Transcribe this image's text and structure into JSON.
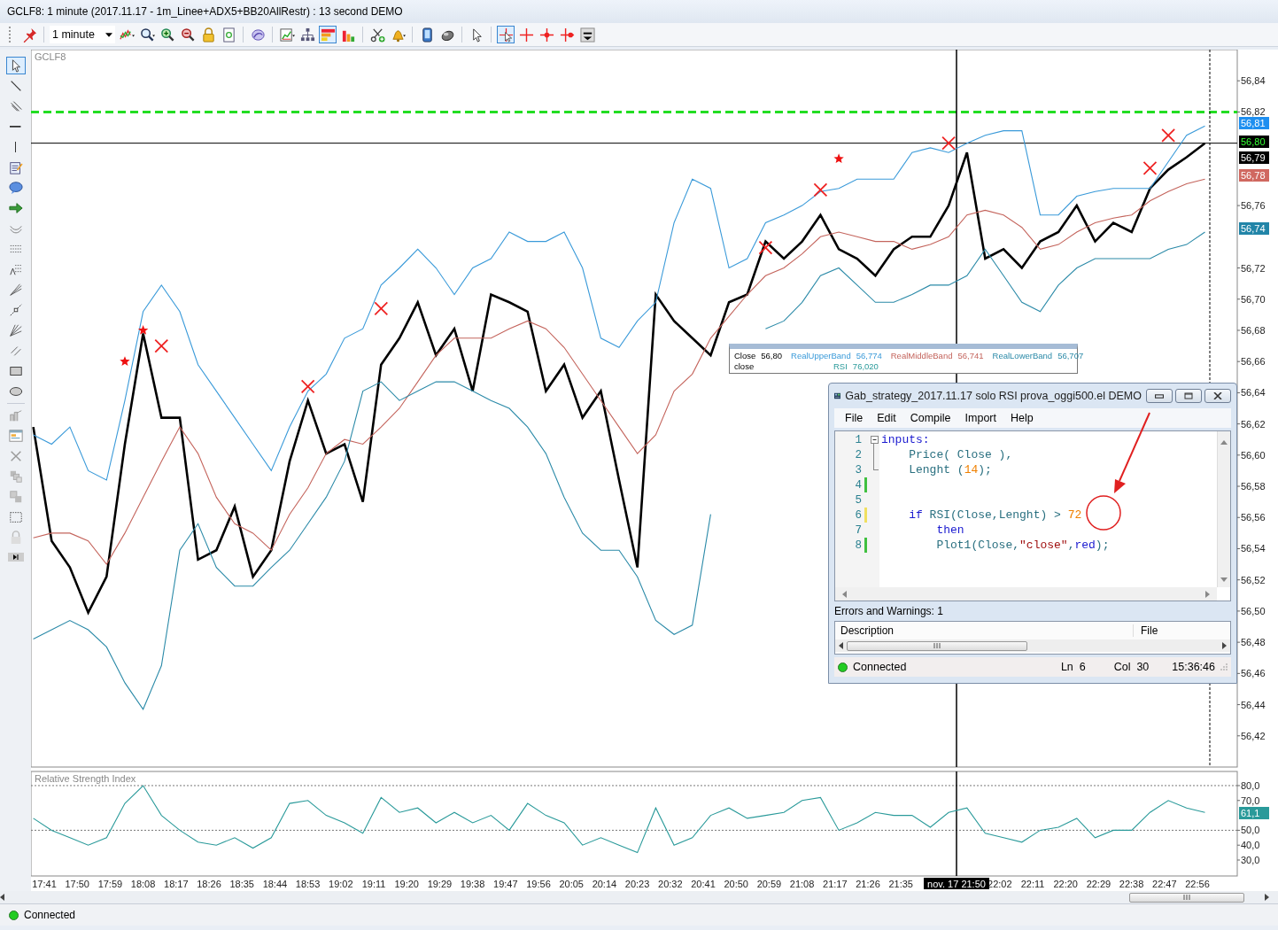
{
  "window": {
    "title": "GCLF8: 1 minute (2017.11.17 - 1m_Linee+ADX5+BB20AllRestr) : 13 second DEMO"
  },
  "toolbar": {
    "interval": "1 minute",
    "buttons": [
      {
        "selected": false
      },
      {
        "selected": false
      },
      {
        "selected": false
      },
      {
        "selected": false
      },
      {
        "selected": false
      },
      {
        "selected": false
      },
      {
        "selected": false
      },
      {
        "selected": false
      },
      {
        "selected": false
      },
      {
        "selected": false
      },
      {
        "selected": true
      },
      {
        "selected": false
      },
      {
        "selected": false
      },
      {
        "selected": false
      },
      {
        "selected": false
      },
      {
        "selected": false
      },
      {
        "selected": false
      },
      {
        "selected": true
      },
      {
        "selected": false
      },
      {
        "selected": false
      },
      {
        "selected": false
      },
      {
        "selected": false
      }
    ]
  },
  "drawing_tools": [
    {
      "selected": true
    },
    {
      "selected": false
    },
    {
      "selected": false
    },
    {
      "selected": false
    },
    {
      "selected": false
    },
    {
      "selected": false
    },
    {
      "selected": false
    },
    {
      "selected": false
    },
    {
      "selected": false
    },
    {
      "selected": false
    },
    {
      "selected": false
    },
    {
      "selected": false
    },
    {
      "selected": false
    },
    {
      "selected": false
    },
    {
      "selected": false
    },
    {
      "selected": false
    },
    {
      "selected": false
    },
    {
      "selected": false
    },
    {
      "selected": false
    },
    {
      "selected": false
    },
    {
      "selected": false
    },
    {
      "selected": false
    },
    {
      "selected": false
    },
    {
      "selected": false
    }
  ],
  "price_chart": {
    "title": "GCLF8",
    "chart_data": {
      "type": "line",
      "categories": [
        null,
        null,
        null,
        null,
        null,
        null,
        null,
        null,
        null,
        null,
        null,
        null,
        null,
        null,
        null,
        null,
        null,
        null,
        null,
        null,
        null,
        null,
        null,
        null,
        null,
        null,
        null,
        null,
        null,
        null,
        null,
        null,
        null,
        null,
        null,
        null,
        null,
        null,
        null,
        null,
        null,
        null,
        null,
        null,
        null,
        null,
        null,
        null,
        null,
        null,
        null,
        null,
        null,
        null,
        null,
        null,
        null,
        null,
        null,
        null,
        null,
        null,
        null,
        null,
        null
      ],
      "ylim": [
        56.4,
        56.86
      ],
      "yticks": [
        {
          "value": 56.42,
          "label": "56,42"
        },
        {
          "value": 56.44,
          "label": "56,44"
        },
        {
          "value": 56.46,
          "label": "56,46"
        },
        {
          "value": 56.48,
          "label": "56,48"
        },
        {
          "value": 56.5,
          "label": "56,50"
        },
        {
          "value": 56.52,
          "label": "56,52"
        },
        {
          "value": 56.54,
          "label": "56,54"
        },
        {
          "value": 56.56,
          "label": "56,56"
        },
        {
          "value": 56.58,
          "label": "56,58"
        },
        {
          "value": 56.6,
          "label": "56,60"
        },
        {
          "value": 56.62,
          "label": "56,62"
        },
        {
          "value": 56.64,
          "label": "56,64"
        },
        {
          "value": 56.66,
          "label": "56,66"
        },
        {
          "value": 56.68,
          "label": "56,68"
        },
        {
          "value": 56.7,
          "label": "56,70"
        },
        {
          "value": 56.72,
          "label": "56,72"
        },
        {
          "value": 56.76,
          "label": "56,76"
        },
        {
          "value": 56.82,
          "label": "56,82"
        },
        {
          "value": 56.84,
          "label": "56,84"
        }
      ],
      "series": [
        {
          "name": "Close",
          "color": "#000000",
          "values": [
            56.618,
            56.545,
            56.528,
            56.499,
            56.522,
            56.607,
            56.678,
            56.624,
            56.624,
            56.533,
            56.539,
            56.567,
            56.522,
            56.539,
            56.596,
            56.635,
            56.601,
            56.607,
            56.57,
            56.658,
            56.675,
            56.698,
            56.664,
            56.681,
            56.641,
            56.703,
            56.698,
            56.692,
            56.641,
            56.658,
            56.624,
            56.641,
            56.584,
            56.528,
            56.703,
            56.686,
            56.675,
            56.664,
            56.698,
            56.703,
            56.737,
            56.726,
            56.737,
            56.754,
            56.732,
            56.726,
            56.715,
            56.732,
            56.74,
            56.74,
            56.76,
            56.794,
            56.726,
            56.732,
            56.72,
            56.737,
            56.743,
            56.76,
            56.737,
            56.749,
            56.743,
            56.771,
            56.783,
            56.791,
            56.8
          ]
        },
        {
          "name": "RealUpperBand",
          "color": "#3a9ad9",
          "values": [
            56.613,
            56.607,
            56.618,
            56.59,
            56.584,
            56.635,
            56.692,
            56.709,
            56.692,
            56.658,
            56.641,
            56.624,
            56.607,
            56.59,
            56.618,
            56.641,
            56.652,
            56.675,
            56.681,
            56.709,
            56.72,
            56.732,
            56.72,
            56.703,
            56.72,
            56.726,
            56.743,
            56.737,
            56.737,
            56.743,
            56.72,
            56.675,
            56.669,
            56.686,
            56.698,
            56.749,
            56.777,
            56.771,
            56.72,
            56.726,
            56.749,
            56.754,
            56.76,
            56.769,
            56.771,
            56.777,
            56.777,
            56.777,
            56.794,
            56.797,
            56.794,
            56.8,
            56.805,
            56.808,
            56.808,
            56.754,
            56.754,
            56.766,
            56.769,
            56.771,
            56.771,
            56.771,
            56.788,
            56.805,
            56.811
          ]
        },
        {
          "name": "RealMiddleBand",
          "color": "#c4645c",
          "values": [
            56.547,
            56.55,
            56.55,
            56.545,
            56.53,
            56.55,
            56.573,
            56.596,
            56.618,
            56.601,
            56.573,
            56.556,
            56.55,
            56.539,
            56.562,
            56.579,
            56.601,
            56.61,
            56.607,
            56.618,
            56.63,
            56.647,
            56.664,
            56.675,
            56.675,
            56.675,
            56.681,
            56.686,
            56.681,
            56.669,
            56.652,
            56.635,
            56.618,
            56.601,
            56.613,
            56.641,
            56.652,
            56.675,
            56.689,
            56.703,
            56.715,
            56.72,
            56.729,
            56.74,
            56.743,
            56.74,
            56.737,
            56.737,
            56.732,
            56.735,
            56.74,
            56.754,
            56.757,
            56.754,
            56.746,
            56.732,
            56.735,
            56.743,
            56.749,
            56.752,
            56.754,
            56.763,
            56.769,
            56.774,
            56.777
          ]
        },
        {
          "name": "RealLowerBand",
          "color": "#2b8aa8",
          "values": [
            56.482,
            56.488,
            56.494,
            56.488,
            56.477,
            56.454,
            56.437,
            56.465,
            56.539,
            56.556,
            56.528,
            56.516,
            56.516,
            56.528,
            56.539,
            56.556,
            56.573,
            56.596,
            56.641,
            56.647,
            56.635,
            56.641,
            56.647,
            56.647,
            56.641,
            56.635,
            56.63,
            56.618,
            56.601,
            56.573,
            56.55,
            56.539,
            56.539,
            56.522,
            56.494,
            56.485,
            56.491,
            56.562,
            null,
            null,
            56.681,
            56.686,
            56.698,
            56.715,
            56.72,
            56.709,
            56.698,
            56.698,
            56.703,
            56.709,
            56.709,
            56.715,
            56.732,
            56.715,
            56.698,
            56.692,
            56.709,
            56.72,
            56.726,
            56.726,
            56.726,
            56.726,
            56.732,
            56.735,
            56.743
          ]
        },
        {
          "name": "close",
          "color": "#ee2222",
          "type": "scatter",
          "marker": "x",
          "values": [
            null,
            null,
            null,
            null,
            null,
            null,
            null,
            56.67,
            null,
            null,
            null,
            null,
            null,
            null,
            null,
            56.644,
            null,
            null,
            null,
            56.694,
            null,
            null,
            null,
            null,
            null,
            null,
            null,
            null,
            null,
            null,
            null,
            null,
            null,
            null,
            null,
            null,
            null,
            null,
            null,
            null,
            56.733,
            null,
            null,
            56.77,
            null,
            null,
            null,
            null,
            null,
            null,
            56.8,
            null,
            null,
            null,
            null,
            null,
            null,
            null,
            null,
            null,
            null,
            56.784,
            56.805,
            null,
            null
          ]
        },
        {
          "color": "#ee1111",
          "type": "scatter",
          "marker": "star",
          "values": [
            null,
            null,
            null,
            null,
            null,
            56.66,
            56.68,
            null,
            null,
            null,
            null,
            null,
            null,
            null,
            null,
            null,
            null,
            null,
            null,
            null,
            null,
            null,
            null,
            null,
            null,
            null,
            null,
            null,
            null,
            null,
            null,
            null,
            null,
            null,
            null,
            null,
            null,
            null,
            null,
            null,
            null,
            null,
            null,
            null,
            56.79,
            null,
            null,
            null,
            null,
            null,
            null,
            null,
            null,
            null,
            null,
            null,
            null,
            null,
            null,
            null,
            null,
            null,
            null,
            null,
            null
          ]
        }
      ],
      "ref_lines": [
        {
          "axis": "y",
          "value": 56.82,
          "color": "#22dd22"
        },
        {
          "axis": "y",
          "value": 56.8,
          "color": "#000000"
        }
      ]
    },
    "price_tags": [
      {
        "label": "56,81",
        "color": "#1e8ff0",
        "kind": "indicator"
      },
      {
        "label": "56,80",
        "color": "#000000",
        "kind": "last_price"
      },
      {
        "label": "56,79",
        "color": "#000000",
        "kind": "indicator"
      },
      {
        "label": "56,78",
        "color": "#d06860",
        "kind": "indicator"
      },
      {
        "label": "56,74",
        "color": "#2285a8",
        "kind": "indicator"
      }
    ]
  },
  "rsi_chart": {
    "title": "Relative Strength Index",
    "chart_data": {
      "type": "line",
      "categories": [
        null,
        null,
        null,
        null,
        null,
        null,
        null,
        null,
        null,
        null,
        null,
        null,
        null,
        null,
        null,
        null,
        null,
        null,
        null,
        null,
        null,
        null,
        null,
        null,
        null,
        null,
        null,
        null,
        null,
        null,
        null,
        null,
        null,
        null,
        null,
        null,
        null,
        null,
        null,
        null,
        null,
        null,
        null,
        null,
        null,
        null,
        null,
        null,
        null,
        null,
        null,
        null,
        null,
        null,
        null,
        null,
        null,
        null,
        null,
        null,
        null,
        null,
        null,
        null,
        null
      ],
      "ylim": [
        19.3,
        89.5
      ],
      "yticks": [
        {
          "value": 30,
          "label": "30,0"
        },
        {
          "value": 40,
          "label": "40,0"
        },
        {
          "value": 50,
          "label": "50,0"
        },
        {
          "value": 70,
          "label": "70,0"
        },
        {
          "value": 80,
          "label": "80,0"
        }
      ],
      "series": [
        {
          "name": "RSI",
          "color": "#2a9a9a",
          "values": [
            58,
            50,
            45,
            40,
            45,
            68,
            80,
            60,
            50,
            42,
            40,
            45,
            38,
            45,
            68,
            70,
            60,
            55,
            48,
            72,
            62,
            65,
            55,
            62,
            55,
            60,
            50,
            68,
            60,
            55,
            40,
            45,
            40,
            35,
            65,
            40,
            45,
            60,
            65,
            58,
            60,
            62,
            70,
            72,
            50,
            55,
            62,
            60,
            60,
            52,
            62,
            65,
            48,
            45,
            42,
            50,
            52,
            58,
            45,
            50,
            50,
            62,
            70,
            65,
            62
          ]
        }
      ],
      "ref_lines": [
        {
          "axis": "y",
          "value": 80,
          "color": "#777777"
        },
        {
          "axis": "y",
          "value": 50,
          "color": "#777777"
        }
      ]
    },
    "price_tags": [
      {
        "label": "61,1",
        "color": "#2a9a9a",
        "kind": "indicator"
      }
    ],
    "time_axis": [
      "17:41",
      "17:50",
      "17:59",
      "18:08",
      "18:17",
      "18:26",
      "18:35",
      "18:44",
      "18:53",
      "19:02",
      "19:11",
      "19:20",
      "19:29",
      "19:38",
      "19:47",
      "19:56",
      "20:05",
      "20:14",
      "20:23",
      "20:32",
      "20:41",
      "20:50",
      "20:59",
      "21:08",
      "21:17",
      "21:26",
      "21:35",
      "22:02",
      "22:11",
      "22:20",
      "22:29",
      "22:38",
      "22:47",
      "22:56"
    ],
    "crosshair_label": "nov. 17 21:50"
  },
  "legend": {
    "values": [
      "56,80",
      "56,774",
      "56,741",
      "56,707"
    ],
    "rsi_value": "76,020"
  },
  "editor": {
    "title": "Gab_strategy_2017.11.17 solo RSI prova_oggi500.el DEMO",
    "menu": [
      "File",
      "Edit",
      "Compile",
      "Import",
      "Help"
    ],
    "lines": [
      {
        "number": "1",
        "collapsible": true,
        "tokens": [
          {
            "text": "inputs:",
            "kind": "keyword"
          }
        ]
      },
      {
        "number": "2",
        "collapsible": false,
        "tokens": [
          {
            "text": "    Price( Close ),",
            "kind": "ident"
          }
        ]
      },
      {
        "number": "3",
        "collapsible": false,
        "tokens": [
          {
            "text": "    Lenght (",
            "kind": "ident"
          },
          {
            "text": "14",
            "kind": "number"
          },
          {
            "text": ");",
            "kind": "ident"
          }
        ]
      },
      {
        "number": "4",
        "color": "#40c040",
        "collapsible": false
      },
      {
        "number": "5",
        "collapsible": false
      },
      {
        "number": "6",
        "color": "#f0e060",
        "collapsible": false,
        "tokens": [
          {
            "text": "    if",
            "kind": "keyword"
          },
          {
            "text": " RSI(Close,Lenght) >",
            "kind": "ident"
          },
          {
            "text": " 72",
            "kind": "number"
          }
        ]
      },
      {
        "number": "7",
        "collapsible": false,
        "tokens": [
          {
            "text": "        then",
            "kind": "keyword"
          }
        ]
      },
      {
        "number": "8",
        "color": "#40c040",
        "collapsible": false,
        "tokens": [
          {
            "text": "        Plot1(Close,",
            "kind": "ident"
          },
          {
            "text": "\"close\"",
            "kind": "string"
          },
          {
            "text": ",",
            "kind": "ident"
          },
          {
            "text": "red",
            "kind": "keyword"
          },
          {
            "text": ");",
            "kind": "ident"
          }
        ]
      }
    ],
    "errors_label": "Errors and Warnings: 1",
    "columns": [
      "Description",
      "File"
    ],
    "status": {
      "connected": true,
      "text": "Connected",
      "line": "Ln  6",
      "column": "Col  30",
      "time": "15:36:46"
    }
  },
  "status_bar": {
    "connected": true,
    "text": "Connected"
  }
}
